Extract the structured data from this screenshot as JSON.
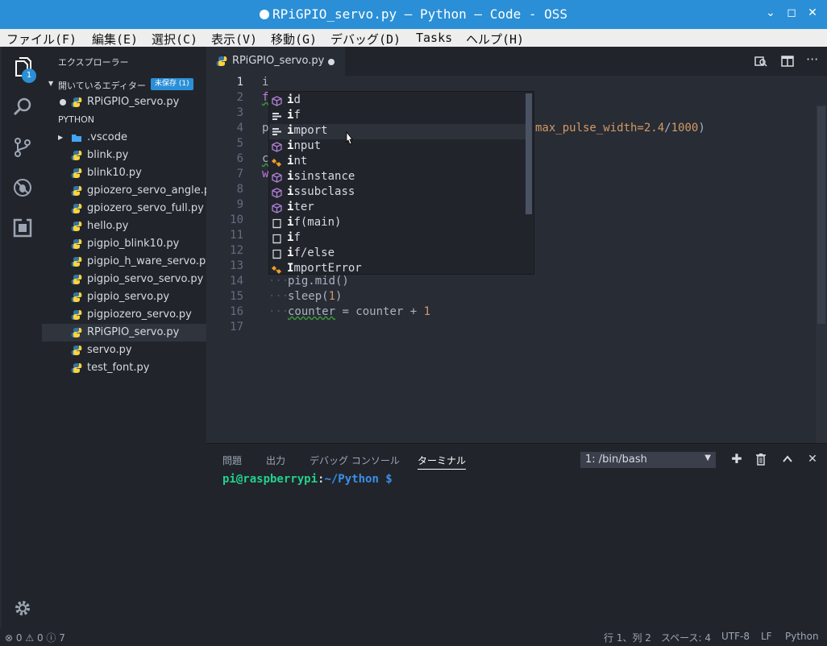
{
  "window": {
    "title": "RPiGPIO_servo.py — Python — Code - OSS",
    "controls": [
      "⌄",
      "◻",
      "✕"
    ]
  },
  "menu": [
    "ファイル(F)",
    "編集(E)",
    "選択(C)",
    "表示(V)",
    "移動(G)",
    "デバッグ(D)",
    "Tasks",
    "ヘルプ(H)"
  ],
  "activity": {
    "explorer_badge": "1"
  },
  "sidebar": {
    "title": "エクスプローラー",
    "open_editors": {
      "label": "開いているエディター",
      "badge": "未保存 (1)",
      "file": "RPiGPIO_servo.py"
    },
    "folder": {
      "label": "PYTHON",
      "items": [
        ".vscode",
        "blink.py",
        "blink10.py",
        "gpiozero_servo_angle.py",
        "gpiozero_servo_full.py",
        "hello.py",
        "pigpio_blink10.py",
        "pigpio_h_ware_servo.py",
        "pigpio_servo_servo.py",
        "pigpio_servo.py",
        "pigpiozero_servo.py",
        "RPiGPIO_servo.py",
        "servo.py",
        "test_font.py"
      ]
    }
  },
  "editor": {
    "tab": "RPiGPIO_servo.py",
    "line_numbers": [
      "1",
      "2",
      "3",
      "4",
      "5",
      "6",
      "7",
      "8",
      "9",
      "10",
      "11",
      "12",
      "13",
      "14",
      "15",
      "16",
      "17"
    ],
    "lines": {
      "l1": "i",
      "l2": "f",
      "l4a": "p",
      "l4b": "max_pulse_width=",
      "l4c": "2.4",
      "l4d": "/",
      "l4e": "1000",
      "l4f": ")",
      "l6": "c",
      "l7": "w",
      "l14": "pig.mid()",
      "l15a": "sleep(",
      "l15b": "1",
      "l15c": ")",
      "l16a": "counter",
      "l16b": " = counter + ",
      "l16c": "1"
    },
    "suggest": [
      {
        "match": "i",
        "rest": "d",
        "icon": "cube-icon"
      },
      {
        "match": "i",
        "rest": "f",
        "icon": "keyword-icon"
      },
      {
        "match": "i",
        "rest": "mport",
        "icon": "keyword-icon"
      },
      {
        "match": "i",
        "rest": "nput",
        "icon": "cube-icon"
      },
      {
        "match": "i",
        "rest": "nt",
        "icon": "class-icon"
      },
      {
        "match": "i",
        "rest": "sinstance",
        "icon": "cube-icon"
      },
      {
        "match": "i",
        "rest": "ssubclass",
        "icon": "cube-icon"
      },
      {
        "match": "i",
        "rest": "ter",
        "icon": "cube-icon"
      },
      {
        "match": "i",
        "rest": "f(main)",
        "icon": "snippet-icon"
      },
      {
        "match": "i",
        "rest": "f",
        "icon": "snippet-icon"
      },
      {
        "match": "i",
        "rest": "f/else",
        "icon": "snippet-icon"
      },
      {
        "match": "I",
        "rest": "mportError",
        "icon": "class-icon"
      }
    ]
  },
  "panel": {
    "tabs": [
      "問題",
      "出力",
      "デバッグ コンソール",
      "ターミナル"
    ],
    "terminal_select": "1: /bin/bash",
    "prompt_user": "pi@raspberrypi",
    "prompt_colon": ":",
    "prompt_path": "~/Python $"
  },
  "status": {
    "errors": "0",
    "warnings": "0",
    "infos": "7",
    "position": "行 1、列 2",
    "spaces": "スペース: 4",
    "encoding": "UTF-8",
    "eol": "LF",
    "language": "Python"
  },
  "colors": {
    "accent": "#2a8fd6",
    "prompt_user": "#23d18b",
    "prompt_path": "#3b8eea"
  }
}
